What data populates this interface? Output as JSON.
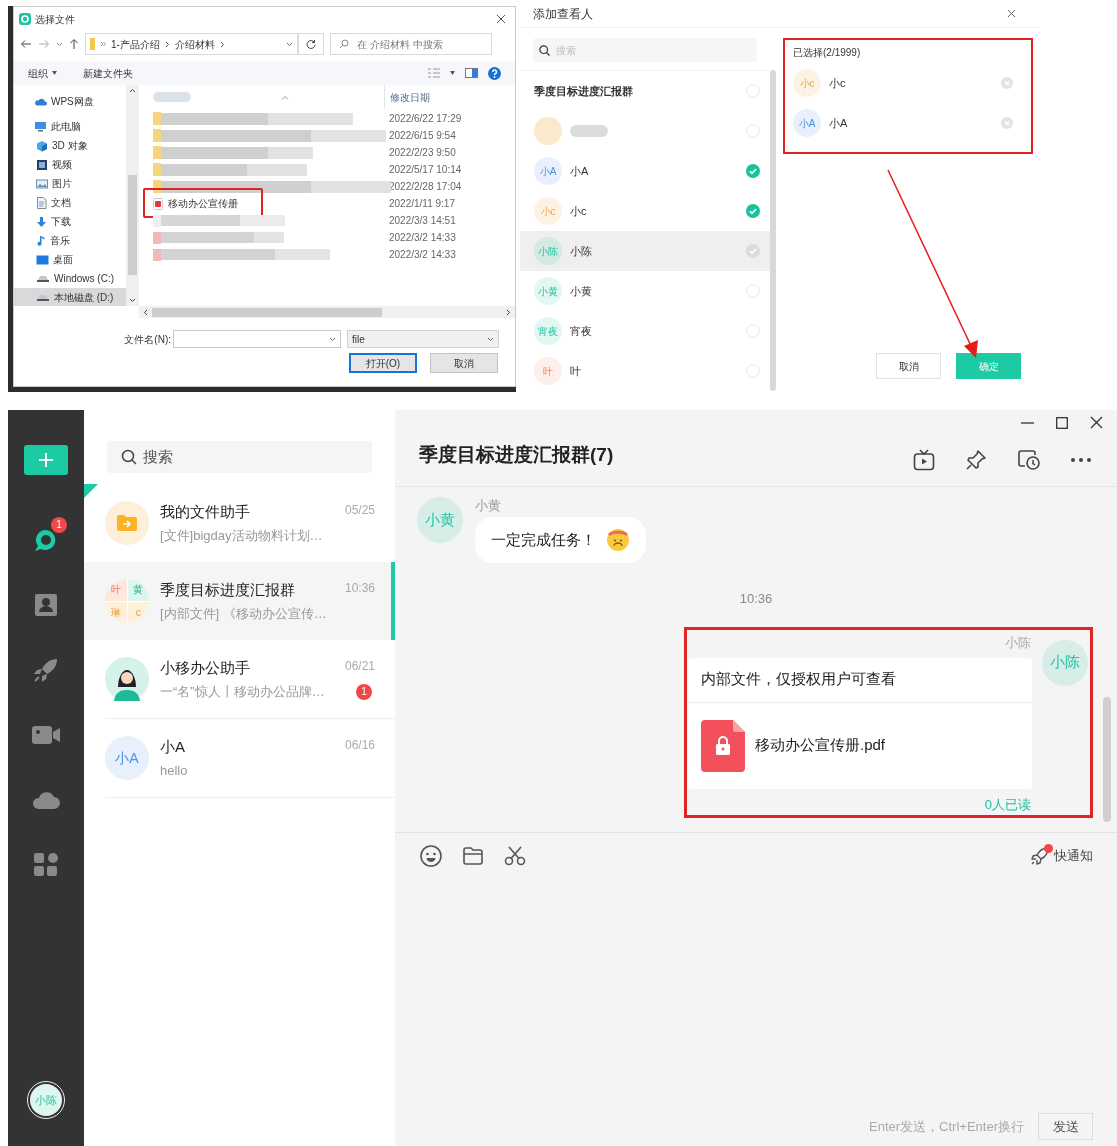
{
  "file_dialog": {
    "title": "选择文件",
    "path": [
      "1-产品介绍",
      "介绍材料"
    ],
    "search": {
      "placeholder": "在 介绍材料 中搜索"
    },
    "toolbar": [
      {
        "label": "组织",
        "dropdown": true
      },
      {
        "label": "新建文件夹",
        "dropdown": false
      }
    ],
    "nav": [
      {
        "label": "WPS网盘",
        "selected": false
      },
      {
        "label": "此电脑",
        "selected": false,
        "children": [
          {
            "label": "3D 对象",
            "selected": false
          },
          {
            "label": "视频",
            "selected": false
          },
          {
            "label": "图片",
            "selected": false
          },
          {
            "label": "文档",
            "selected": false
          },
          {
            "label": "下载",
            "selected": false
          },
          {
            "label": "音乐",
            "selected": false
          },
          {
            "label": "桌面",
            "selected": false
          },
          {
            "label": "Windows (C:)",
            "selected": false
          },
          {
            "label": "本地磁盘 (D:)",
            "selected": true
          }
        ]
      }
    ],
    "date_header": "修改日期",
    "files": [
      {
        "kind": "folder",
        "date": "2022/6/22 17:29",
        "highlighted": false
      },
      {
        "kind": "folder",
        "date": "2022/6/15 9:54",
        "highlighted": false
      },
      {
        "kind": "folder",
        "date": "2022/2/23 9:50",
        "highlighted": false
      },
      {
        "kind": "folder",
        "date": "2022/5/17 10:14",
        "highlighted": false
      },
      {
        "kind": "folder",
        "date": "2022/2/28 17:04",
        "highlighted": false
      },
      {
        "kind": "pdf",
        "name": "移动办公宣传册",
        "date": "2022/1/11 9:17",
        "highlighted": true
      },
      {
        "kind": "file",
        "date": "2022/3/3 14:51",
        "highlighted": false
      },
      {
        "kind": "pdf-blurred",
        "date": "2022/3/2 14:33",
        "highlighted": false
      },
      {
        "kind": "pdf-blurred",
        "date": "2022/3/2 14:33",
        "highlighted": false
      }
    ],
    "filename_label": "文件名(N):",
    "filetype": "file",
    "buttons": [
      {
        "label": "打开(O)",
        "primary": true
      },
      {
        "label": "取消",
        "primary": false
      }
    ]
  },
  "viewer_dialog": {
    "title": "添加查看人",
    "search": {
      "placeholder": "搜索"
    },
    "group": {
      "name": "季度目标进度汇报群",
      "checked": false
    },
    "members": [
      {
        "kind": "blurred",
        "checked": false,
        "disabled": false,
        "hovered": false
      },
      {
        "kind": "person",
        "name": "小A",
        "avatar": "小A",
        "checked": true,
        "disabled": false,
        "hovered": false
      },
      {
        "kind": "person",
        "name": "小c",
        "avatar": "小c",
        "checked": true,
        "disabled": false,
        "hovered": false
      },
      {
        "kind": "person",
        "name": "小陈",
        "avatar": "小陈",
        "checked": true,
        "disabled": true,
        "hovered": true
      },
      {
        "kind": "person",
        "name": "小黄",
        "avatar": "小黄",
        "checked": false,
        "disabled": false,
        "hovered": false
      },
      {
        "kind": "person",
        "name": "宵夜",
        "avatar": "宵夜",
        "checked": false,
        "disabled": false,
        "hovered": false
      },
      {
        "kind": "person",
        "name": "叶",
        "avatar": "叶",
        "checked": false,
        "disabled": false,
        "hovered": false
      }
    ],
    "chosen_title": "已选择(2/1999)",
    "chosen": [
      {
        "name": "小c",
        "avatar": "小c"
      },
      {
        "name": "小A",
        "avatar": "小A"
      }
    ],
    "buttons": [
      {
        "label": "取消",
        "primary": false
      },
      {
        "label": "确定",
        "primary": true
      }
    ]
  },
  "app": {
    "rail": [
      {
        "badge": "1",
        "selected": true
      },
      {
        "selected": false
      },
      {
        "selected": false
      },
      {
        "selected": false
      },
      {
        "selected": false
      },
      {
        "selected": false
      }
    ],
    "user_avatar": "小陈",
    "search": {
      "placeholder": "搜索"
    },
    "conversations": [
      {
        "avatar": {
          "kind": "folder"
        },
        "title": "我的文件助手",
        "preview": "[文件]bigday活动物料计划…",
        "time": "05/25",
        "pinned": true,
        "selected": false
      },
      {
        "avatar": {
          "kind": "group",
          "cells": [
            "叶",
            "黄",
            "琳",
            "c"
          ]
        },
        "title": "季度目标进度汇报群",
        "preview": "[内部文件] 《移动办公宣传…",
        "time": "10:36",
        "pinned": false,
        "selected": true
      },
      {
        "avatar": {
          "kind": "figure"
        },
        "title": "小移办公助手",
        "preview": "一“名”惊人丨移动办公品牌…",
        "time": "06/21",
        "unread": "1",
        "pinned": false,
        "selected": false
      },
      {
        "avatar": {
          "kind": "text",
          "text": "小A"
        },
        "title": "小A",
        "preview": "hello",
        "time": "06/16",
        "pinned": false,
        "selected": false
      }
    ],
    "chat": {
      "title": "季度目标进度汇报群(7)",
      "messages": [
        {
          "kind": "incoming",
          "sender": "小黄",
          "avatar": "小黄",
          "text": "一定完成任务！",
          "emoji": true
        },
        {
          "kind": "time",
          "text": "10:36"
        },
        {
          "kind": "file",
          "sender": "小陈",
          "avatar": "小陈",
          "notice": "内部文件，仅授权用户可查看",
          "file": "移动办公宣传册.pdf",
          "read": "0人已读",
          "highlighted": true
        }
      ],
      "quick_notice": {
        "label": "快通知",
        "dot": true
      },
      "hint": "Enter发送，Ctrl+Enter换行",
      "send": "发送"
    }
  }
}
